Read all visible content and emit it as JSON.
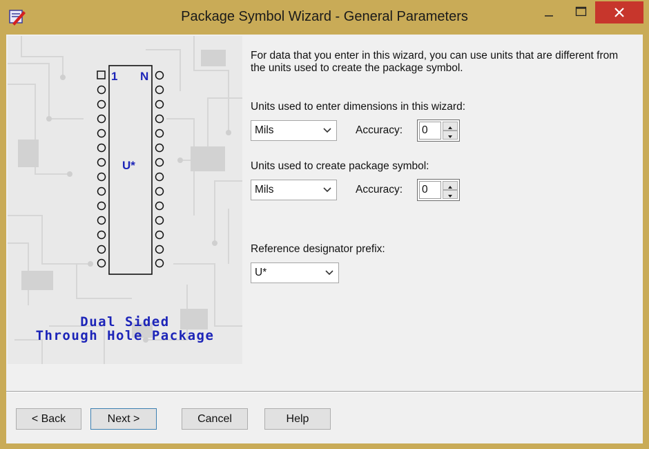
{
  "window": {
    "title": "Package Symbol Wizard - General Parameters",
    "accent": "#c9ab57",
    "close_color": "#c7362c"
  },
  "art": {
    "pin_first": "1",
    "pin_last": "N",
    "refdes": "U*",
    "caption_line1": "Dual Sided",
    "caption_line2": "Through Hole Package",
    "caption_color": "#1c24b8"
  },
  "form": {
    "instructions": "For data that you enter in this wizard, you can use units that are different from the units used to create the package symbol.",
    "wizard_units_label": "Units used to enter dimensions in this wizard:",
    "wizard_units_value": "Mils",
    "wizard_accuracy_label": "Accuracy:",
    "wizard_accuracy_value": "0",
    "symbol_units_label": "Units used to create package symbol:",
    "symbol_units_value": "Mils",
    "symbol_accuracy_label": "Accuracy:",
    "symbol_accuracy_value": "0",
    "refdes_label": "Reference designator prefix:",
    "refdes_value": "U*"
  },
  "buttons": {
    "back": "< Back",
    "next": "Next >",
    "cancel": "Cancel",
    "help": "Help"
  }
}
